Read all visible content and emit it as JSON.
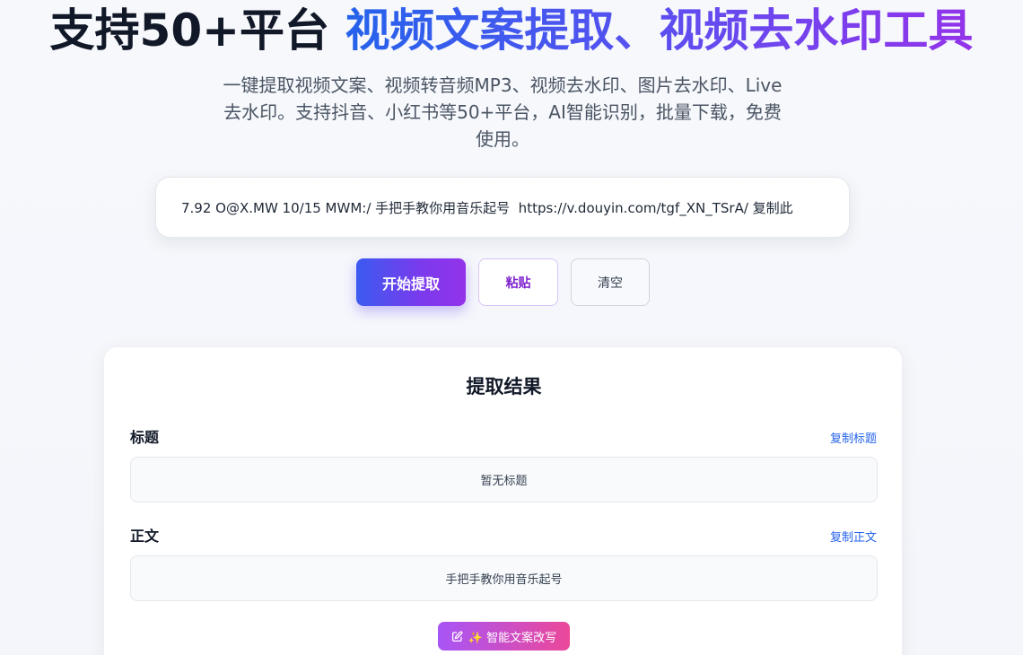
{
  "hero": {
    "title_plain": "支持50+平台 ",
    "title_gradient": "视频文案提取、视频去水印工具",
    "subtitle": "一键提取视频文案、视频转音频MP3、视频去水印、图片去水印、Live去水印。支持抖音、小红书等50+平台，AI智能识别，批量下载，免费使用。"
  },
  "input": {
    "value": "7.92 O@X.MW 10/15 MWM:/ 手把手教你用音乐起号  https://v.douyin.com/tgf_XN_TSrA/ 复制此"
  },
  "buttons": {
    "start": "开始提取",
    "paste": "粘贴",
    "clear": "清空"
  },
  "result": {
    "heading": "提取结果",
    "title_label": "标题",
    "copy_title": "复制标题",
    "title_value": "暂无标题",
    "body_label": "正文",
    "copy_body": "复制正文",
    "body_value": "手把手教你用音乐起号",
    "rewrite_label": "✨ 智能文案改写"
  },
  "icons": {
    "rewrite": "edit-icon"
  },
  "colors": {
    "accent_blue": "#2563eb",
    "accent_purple": "#9333ea",
    "accent_pink": "#ec4899"
  }
}
